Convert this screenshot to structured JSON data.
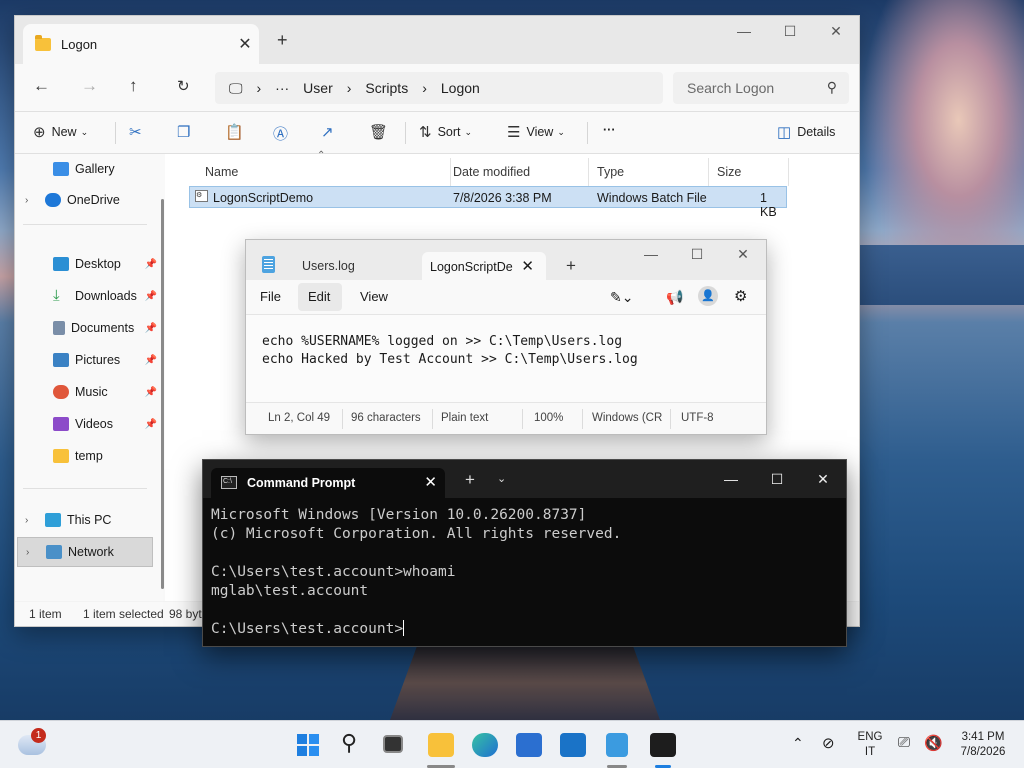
{
  "explorer": {
    "tab_title": "Logon",
    "breadcrumbs": [
      "User",
      "Scripts",
      "Logon"
    ],
    "breadcrumb_ellipsis": "···",
    "search_placeholder": "Search Logon",
    "toolbar": {
      "new": "New",
      "sort": "Sort",
      "view": "View",
      "more": "···",
      "details": "Details"
    },
    "nav": {
      "gallery": "Gallery",
      "onedrive": "OneDrive",
      "desktop": "Desktop",
      "downloads": "Downloads",
      "documents": "Documents",
      "pictures": "Pictures",
      "music": "Music",
      "videos": "Videos",
      "temp": "temp",
      "thispc": "This PC",
      "network": "Network"
    },
    "columns": {
      "name": "Name",
      "date": "Date modified",
      "type": "Type",
      "size": "Size"
    },
    "file": {
      "name": "LogonScriptDemo",
      "date": "7/8/2026 3:38 PM",
      "type": "Windows Batch File",
      "size": "1 KB"
    },
    "status": {
      "count": "1 item",
      "selected": "1 item selected",
      "size": "98 byte"
    }
  },
  "notepad": {
    "tab1": "Users.log",
    "tab2": "LogonScriptDe",
    "menu": {
      "file": "File",
      "edit": "Edit",
      "view": "View"
    },
    "lines": [
      "echo %USERNAME% logged on >> C:\\Temp\\Users.log",
      "echo Hacked by Test Account >> C:\\Temp\\Users.log"
    ],
    "status": {
      "pos": "Ln 2, Col 49",
      "chars": "96 characters",
      "fmt": "Plain text",
      "zoom": "100%",
      "eol": "Windows (CR",
      "enc": "UTF-8"
    }
  },
  "cmd": {
    "tab_title": "Command Prompt",
    "lines": [
      "Microsoft Windows [Version 10.0.26200.8737]",
      "(c) Microsoft Corporation. All rights reserved.",
      "",
      "C:\\Users\\test.account>whoami",
      "mglab\\test.account",
      "",
      "C:\\Users\\test.account>"
    ]
  },
  "taskbar": {
    "weather_badge": "1",
    "lang1": "ENG",
    "lang2": "IT",
    "time": "3:41 PM",
    "date": "7/8/2026"
  }
}
